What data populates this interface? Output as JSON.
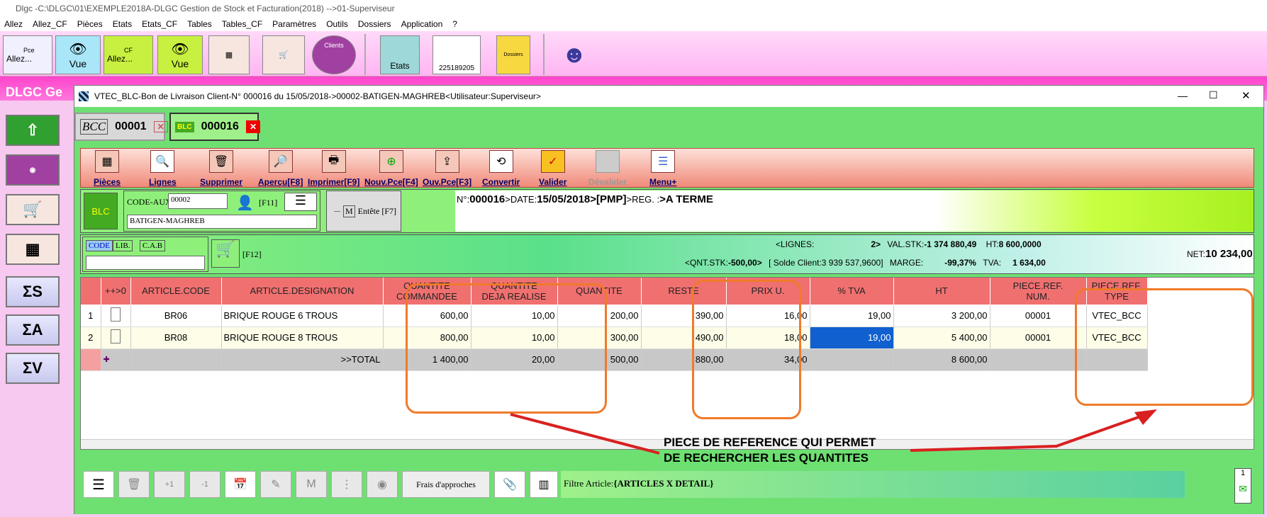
{
  "title_bar": "Dlgc -C:\\DLGC\\01\\EXEMPLE2018A-DLGC Gestion de Stock et Facturation(2018) -->01-Superviseur",
  "menu": [
    "Allez",
    "Allez_CF",
    "Pièces",
    "Etats",
    "Etats_CF",
    "Tables",
    "Tables_CF",
    "Paramètres",
    "Outils",
    "Dossiers",
    "Application",
    "?"
  ],
  "toolbar": {
    "pce": "Pce",
    "allez": "Allez...",
    "vue": "Vue",
    "cf": "CF",
    "allez2": "Allez...",
    "vue2": "Vue",
    "clients": "Clients",
    "etats": "Etats",
    "barcode": "225189205",
    "dossier": "Dossiers"
  },
  "bg_title": "DLGC Ge",
  "window": {
    "title": "VTEC_BLC-Bon de Livraison Client-N° 000016 du 15/05/2018->00002-BATIGEN-MAGHREB<Utilisateur:Superviseur>",
    "min": "—",
    "max": "☐",
    "close": "✕"
  },
  "tabs": [
    {
      "icon": "BCC",
      "num": "00001"
    },
    {
      "icon": "BLC",
      "num": "000016"
    }
  ],
  "actions": [
    "Pièces",
    "Lignes",
    "Supprimer",
    "Aperçu[F8]",
    "Imprimer[F9]",
    "Nouv.Pce[F4]",
    "Ouv.Pce[F3]",
    "Convertir",
    "Valider",
    "Dévalider",
    "Menu+"
  ],
  "header": {
    "code_aux_label": "CODE-AUX:",
    "code_aux_value": "00002",
    "f11": "[F11]",
    "client_name": "BATIGEN-MAGHREB",
    "entete": "Entête [F7]",
    "m_key": "M",
    "minus": "—",
    "info_n_label": "N°:",
    "info_n": "000016",
    "info_date_label": ">DATE:",
    "info_date": "15/05/2018",
    "info_pmp": ">[PMP]",
    "info_reg_label": ">REG. :",
    "info_reg": ">A TERME"
  },
  "search": {
    "code": "CODE",
    "lib": "LIB.",
    "cab": "C.A.B",
    "f12": "[F12]",
    "lignes_label": "<LIGNES:",
    "lignes": "2>",
    "valstk_label": "VAL.STK:",
    "valstk": "-1 374 880,49",
    "ht_label": "HT:",
    "ht": "8 600,0000",
    "qntstk_label": "<QNT.STK:",
    "qntstk": "-500,00>",
    "solde": "[ Solde Client:3 939 537,9600]",
    "marge_label": "MARGE:",
    "marge": "-99,37%",
    "tva_label": "TVA:",
    "tva": "1 634,00",
    "net_label": "NET:",
    "net": "10 234,00"
  },
  "grid": {
    "headers": [
      "",
      "++>0",
      "ARTICLE.CODE",
      "ARTICLE.DESIGNATION",
      "QUANTITE\nCOMMANDEE",
      "QUANTITE\nDEJA REALISE",
      "QUANTITE",
      "RESTE",
      "PRIX U.",
      "% TVA",
      "HT",
      "PIECE.REF.\nNUM.",
      "PIECE.REF.\nTYPE"
    ],
    "rows": [
      [
        "1",
        "",
        "BR06",
        "BRIQUE ROUGE 6 TROUS",
        "600,00",
        "10,00",
        "200,00",
        "390,00",
        "16,00",
        "19,00",
        "3 200,00",
        "00001",
        "VTEC_BCC"
      ],
      [
        "2",
        "",
        "BR08",
        "BRIQUE ROUGE 8 TROUS",
        "800,00",
        "10,00",
        "300,00",
        "490,00",
        "18,00",
        "19,00",
        "5 400,00",
        "00001",
        "VTEC_BCC"
      ]
    ],
    "total": [
      "",
      "",
      "",
      "",
      ">>TOTAL",
      "1 400,00",
      "20,00",
      "500,00",
      "880,00",
      "34,00",
      "",
      "8 600,00",
      "",
      ""
    ]
  },
  "annotation": "PIECE DE REFERENCE QUI PERMET\nDE RECHERCHER LES QUANTITES",
  "bottom": {
    "frais": "Frais d'approches",
    "filtre_label": "Filtre Article:",
    "filtre": "{ARTICLES X DETAIL}",
    "page": "1"
  },
  "colors": {
    "accent_red": "#f07070",
    "green": "#6ee072",
    "annotation": "#f07a2a",
    "arrow": "#d92020"
  }
}
